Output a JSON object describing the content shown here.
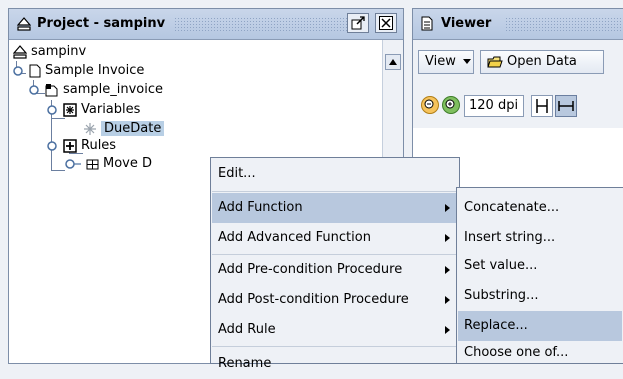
{
  "project_panel": {
    "title": "Project - sampinv",
    "tree": {
      "root": "sampinv",
      "invoice": "Sample Invoice",
      "sample_invoice": "sample_invoice",
      "variables": "Variables",
      "due_date": "DueDate",
      "rules": "Rules",
      "move": "Move D"
    }
  },
  "viewer_panel": {
    "title": "Viewer",
    "view_label": "View",
    "open_data_label": "Open Data",
    "zoom_value": "120 dpi"
  },
  "context_menu": {
    "items": [
      "Edit...",
      "Add Function",
      "Add Advanced Function",
      "Add Pre-condition Procedure",
      "Add Post-condition Procedure",
      "Add Rule",
      "Rename"
    ]
  },
  "function_submenu": {
    "items": [
      "Concatenate...",
      "Insert string...",
      "Set value...",
      "Substring...",
      "Replace...",
      "Choose one of..."
    ]
  },
  "colors": {
    "title_gradient": "#c9d6ea",
    "menu_bg": "#eef1f6",
    "highlight": "#b8c8de",
    "selection": "#b8cfe5"
  }
}
